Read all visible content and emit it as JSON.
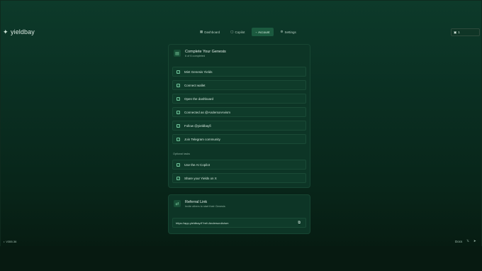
{
  "brand": {
    "name": "yieldbay",
    "icon": "sparkle-icon"
  },
  "nav": [
    {
      "label": "Dashboard",
      "icon": "grid-icon",
      "active": false
    },
    {
      "label": "Copilot",
      "icon": "chat-icon",
      "active": false
    },
    {
      "label": "Account",
      "icon": "user-icon",
      "active": true
    },
    {
      "label": "Settings",
      "icon": "gear-icon",
      "active": false
    }
  ],
  "wallet": {
    "label": "1",
    "icon": "wallet-icon"
  },
  "genesis": {
    "title": "Complete Your Genesis",
    "subtitle": "6 of 6 completed",
    "tasks": [
      "Mint Genesis Yields",
      "Connect wallet",
      "Open the dashboard",
      "Connected as @AndersonAvism",
      "Follow @yieldbayfi",
      "Join Telegram community"
    ],
    "optional_label": "Optional tasks",
    "optional_tasks": [
      "Use the AI Copilot",
      "Share your Yields on X"
    ]
  },
  "referral": {
    "title": "Referral Link",
    "subtitle": "Invite others to start their Genesis",
    "link": "https://app.yieldbay.fi?ref=AndersonAvism"
  },
  "footer": {
    "version": "V355.36",
    "docs": "Docs",
    "icons": [
      "x-icon",
      "telegram-icon"
    ]
  }
}
